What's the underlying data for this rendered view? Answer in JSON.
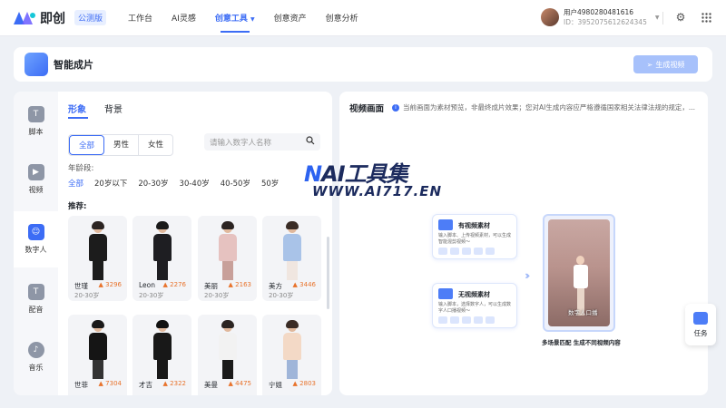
{
  "top": {
    "brand": "即创",
    "beta": "公测版",
    "nav": [
      "工作台",
      "AI灵感",
      "创意工具",
      "创意资产",
      "创意分析"
    ],
    "active": 2,
    "user_name": "用户4980280481616",
    "user_id": "ID：3952075612624345"
  },
  "header": {
    "title": "智能成片",
    "gen_btn": "生成视频"
  },
  "sidebar": [
    {
      "label": "脚本",
      "icon": "script-icon"
    },
    {
      "label": "视频",
      "icon": "video-icon"
    },
    {
      "label": "数字人",
      "icon": "avatar-icon"
    },
    {
      "label": "配音",
      "icon": "voice-icon"
    },
    {
      "label": "音乐",
      "icon": "music-icon"
    }
  ],
  "panel": {
    "tabs": [
      "形象",
      "背景"
    ],
    "gender": [
      "全部",
      "男性",
      "女性"
    ],
    "search_placeholder": "请输入数字人名称",
    "age_label": "年龄段:",
    "ages": [
      "全部",
      "20岁以下",
      "20-30岁",
      "30-40岁",
      "40-50岁",
      "50岁"
    ],
    "rec_label": "推荐:",
    "cards": [
      {
        "name": "世瑾",
        "hot": "3296",
        "age": "20-30岁",
        "body": "#1c1c1c",
        "legs": "#1c1c1c",
        "hair": "#2b2422"
      },
      {
        "name": "Leon",
        "hot": "2276",
        "age": "20-30岁",
        "body": "#1e1e22",
        "legs": "#1e1e22",
        "hair": "#1a1a1a"
      },
      {
        "name": "美丽",
        "hot": "2163",
        "age": "20-30岁",
        "body": "#e6c2c0",
        "legs": "#c8a09a",
        "hair": "#2b2422"
      },
      {
        "name": "美方",
        "hot": "3446",
        "age": "20-30岁",
        "body": "#a9c3e8",
        "legs": "#f0e6e0",
        "hair": "#3a2c26"
      },
      {
        "name": "世菲",
        "hot": "7304",
        "age": "",
        "body": "#151515",
        "legs": "#333",
        "hair": "#1a1a1a"
      },
      {
        "name": "才吉",
        "hot": "2322",
        "age": "",
        "body": "#181818",
        "legs": "#181818",
        "hair": "#111"
      },
      {
        "name": "美曼",
        "hot": "4475",
        "age": "",
        "body": "#f2f2f2",
        "legs": "#1a1a1a",
        "hair": "#2b2422"
      },
      {
        "name": "宁姐",
        "hot": "2803",
        "age": "",
        "body": "#f3d9c6",
        "legs": "#9fb5d9",
        "hair": "#3a2c26"
      }
    ]
  },
  "preview": {
    "title": "视频画面",
    "note": "当前画面为素材预览，非最终成片效果；您对AI生成内容应严格遵循国家相关法律法规的规定，...",
    "watermark1": "AI工具集",
    "watermark1_prefix": "N",
    "watermark2": "WWW.AI717.EN",
    "opt1_title": "有视频素材",
    "opt1_desc": "输入脚本、上传视频素材，可以生成智能混剪视频～",
    "opt2_title": "无视频素材",
    "opt2_desc": "输入脚本，选择数字人，可以生成数字人口播视频～",
    "result_cap": "数字人口播",
    "bottom_cap": "多场景匹配 生成不同视频内容"
  },
  "task": "任务"
}
